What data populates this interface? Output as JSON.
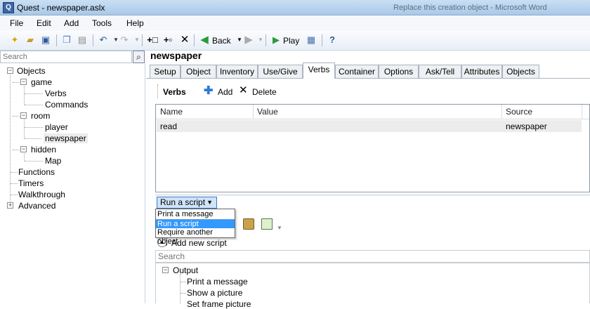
{
  "window": {
    "title": "Quest - newspaper.aslx",
    "background_title": "Replace this creation object - Microsoft Word"
  },
  "menu": [
    "File",
    "Edit",
    "Add",
    "Tools",
    "Help"
  ],
  "toolbar": {
    "back_label": "Back",
    "play_label": "Play"
  },
  "left": {
    "search_placeholder": "Search",
    "tree": {
      "objects": "Objects",
      "game": "game",
      "verbs": "Verbs",
      "commands": "Commands",
      "room": "room",
      "player": "player",
      "newspaper": "newspaper",
      "hidden": "hidden",
      "map": "Map",
      "functions": "Functions",
      "timers": "Timers",
      "walkthrough": "Walkthrough",
      "advanced": "Advanced"
    }
  },
  "editor": {
    "object_name": "newspaper",
    "tabs": [
      "Setup",
      "Object",
      "Inventory",
      "Use/Give",
      "Verbs",
      "Container",
      "Options",
      "Ask/Tell",
      "Attributes",
      "Objects"
    ],
    "active_tab": "Verbs",
    "verbs_label": "Verbs",
    "add_label": "Add",
    "delete_label": "Delete",
    "grid": {
      "headers": [
        "Name",
        "Value",
        "Source"
      ],
      "rows": [
        {
          "name": "read",
          "value": "",
          "source": "newspaper"
        }
      ]
    },
    "script_button": "Run a script",
    "dropdown_options": [
      "Print a message",
      "Run a script",
      "Require another object"
    ],
    "dropdown_selected": "Run a script",
    "add_new_script": "Add new script",
    "search_placeholder": "Search",
    "script_tree": {
      "category": "Output",
      "items": [
        "Print a message",
        "Show a picture",
        "Set frame picture"
      ]
    }
  },
  "colors": {
    "accent": "#3399ff",
    "selected_row": "#ececec"
  }
}
